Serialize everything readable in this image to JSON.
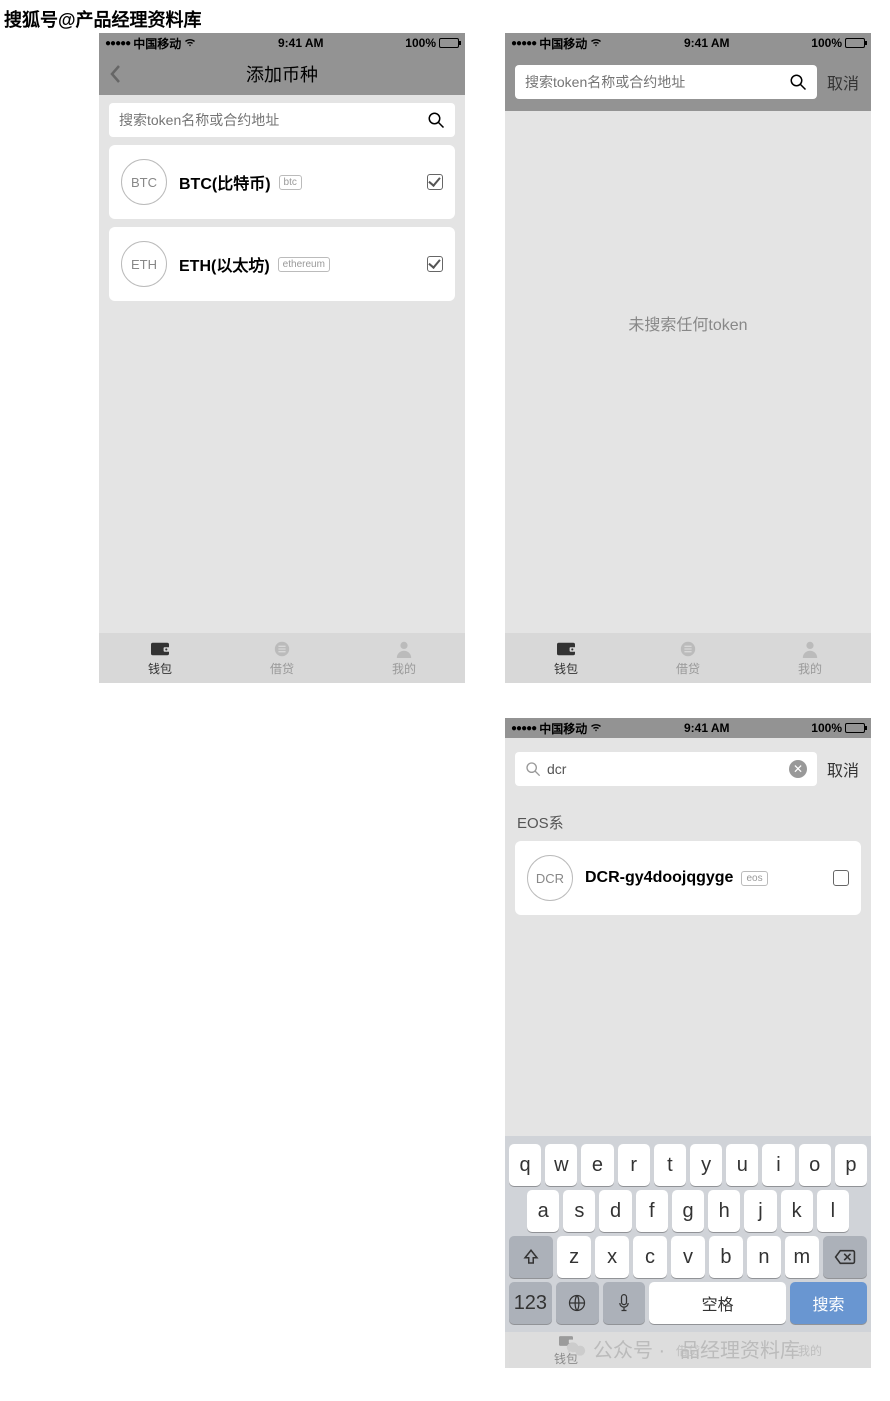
{
  "watermarks": {
    "top": "搜狐号@产品经理资料库",
    "bottom_left": "公众号 ·",
    "bottom_right": "品经理资料库"
  },
  "statusbar": {
    "carrier": "中国移动",
    "time": "9:41 AM",
    "battery": "100%"
  },
  "screen1": {
    "title": "添加币种",
    "search_placeholder": "搜索token名称或合约地址",
    "tokens": [
      {
        "symbol": "BTC",
        "name": "BTC(比特币)",
        "tag": "btc",
        "checked": true
      },
      {
        "symbol": "ETH",
        "name": "ETH(以太坊)",
        "tag": "ethereum",
        "checked": true
      }
    ]
  },
  "screen2": {
    "search_placeholder": "搜索token名称或合约地址",
    "cancel": "取消",
    "empty": "未搜索任何token"
  },
  "screen3": {
    "search_value": "dcr",
    "cancel": "取消",
    "section": "EOS系",
    "result": {
      "symbol": "DCR",
      "name": "DCR-gy4doojqgyge",
      "tag": "eos",
      "checked": false
    }
  },
  "tabs": {
    "wallet": "钱包",
    "loan": "借贷",
    "mine": "我的"
  },
  "keyboard": {
    "row1": [
      "q",
      "w",
      "e",
      "r",
      "t",
      "y",
      "u",
      "i",
      "o",
      "p"
    ],
    "row2": [
      "a",
      "s",
      "d",
      "f",
      "g",
      "h",
      "j",
      "k",
      "l"
    ],
    "row3": [
      "z",
      "x",
      "c",
      "v",
      "b",
      "n",
      "m"
    ],
    "num": "123",
    "space": "空格",
    "search": "搜索"
  }
}
